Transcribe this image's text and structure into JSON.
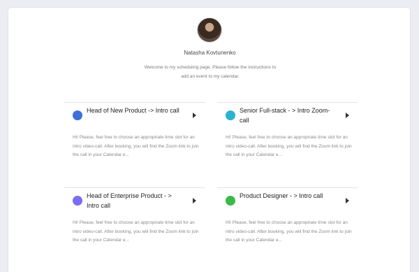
{
  "profile": {
    "name": "Natasha Kovtunenko",
    "welcome": "Welcome to my scheduling page. Please follow the instructions to add an event to my calendar."
  },
  "events": [
    {
      "title": "Head of New Product -> Intro call",
      "color": "#3f6fd8",
      "description": "Hi! Please, feel free to choose an appropriate time slot for an intro video-call. After booking, you will find the Zoom link to join the call in your Calendar e..."
    },
    {
      "title": "Senior Full-stack - > Intro Zoom-call",
      "color": "#2bb3cf",
      "description": "Hi! Please, feel free to choose an appropriate time slot for an intro video-call. After booking, you will find the Zoom link to join the call in your Calendar e..."
    },
    {
      "title": "Head of Enterprise Product - > Intro call",
      "color": "#7b6ef0",
      "description": "Hi! Please, feel free to choose an appropriate time slot for an intro video-call. After booking, you will find the Zoom link to join the call in your Calendar e..."
    },
    {
      "title": "Product Designer - > Intro call",
      "color": "#3cb94a",
      "description": "Hi! Please, feel free to choose an appropriate time slot for an intro video-call. After booking, you will find the Zoom link to join the call in your Calendar e..."
    }
  ]
}
